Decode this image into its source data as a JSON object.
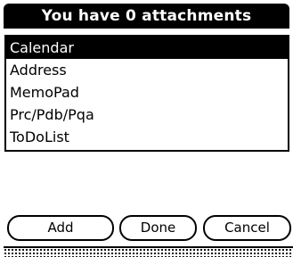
{
  "dialog": {
    "title": "You have 0 attachments"
  },
  "list": {
    "items": [
      {
        "label": "Calendar",
        "selected": true
      },
      {
        "label": "Address",
        "selected": false
      },
      {
        "label": "MemoPad",
        "selected": false
      },
      {
        "label": "Prc/Pdb/Pqa",
        "selected": false
      },
      {
        "label": "ToDoList",
        "selected": false
      }
    ]
  },
  "buttons": {
    "add_label": "Add",
    "done_label": "Done",
    "cancel_label": "Cancel"
  }
}
